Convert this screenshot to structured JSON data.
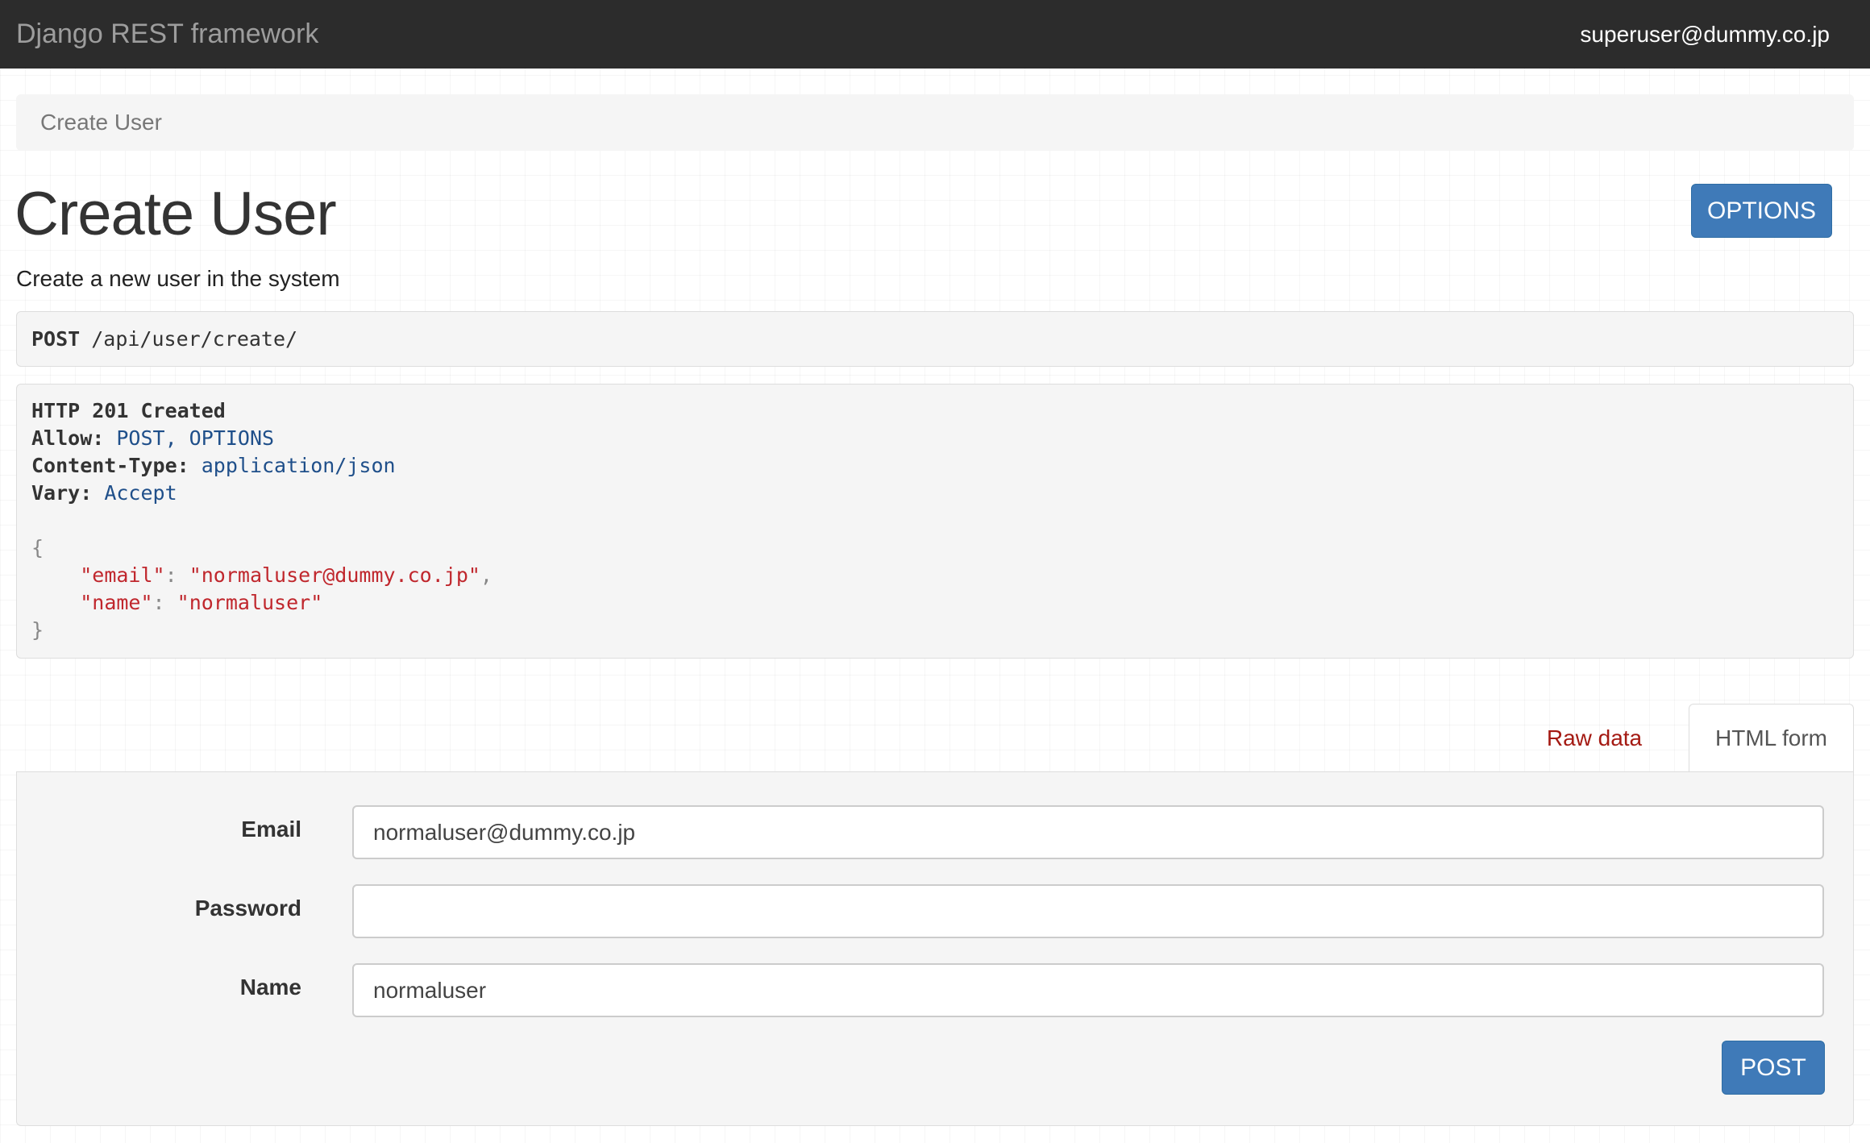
{
  "navbar": {
    "brand": "Django REST framework",
    "user": "superuser@dummy.co.jp"
  },
  "breadcrumb": {
    "current": "Create User"
  },
  "header": {
    "title": "Create User",
    "description": "Create a new user in the system",
    "options_label": "OPTIONS"
  },
  "request": {
    "method": "POST",
    "url": "/api/user/create/"
  },
  "response": {
    "status": "HTTP 201 Created",
    "headers": [
      {
        "key": "Allow:",
        "value": "POST, OPTIONS"
      },
      {
        "key": "Content-Type:",
        "value": "application/json"
      },
      {
        "key": "Vary:",
        "value": "Accept"
      }
    ],
    "body_open": "{",
    "body_close": "}",
    "body": [
      {
        "key": "\"email\"",
        "value": "\"normaluser@dummy.co.jp\"",
        "trail": ","
      },
      {
        "key": "\"name\"",
        "value": "\"normaluser\"",
        "trail": ""
      }
    ]
  },
  "tabs": {
    "raw_data": "Raw data",
    "html_form": "HTML form"
  },
  "form": {
    "email_label": "Email",
    "email_value": "normaluser@dummy.co.jp",
    "password_label": "Password",
    "password_value": "",
    "name_label": "Name",
    "name_value": "normaluser",
    "submit_label": "POST"
  },
  "colors": {
    "navbar_bg": "#2c2c2c",
    "button_primary": "#3f7ab8",
    "link_red": "#a41a13",
    "json_string": "#c0272d",
    "header_value": "#1f4f8a"
  }
}
